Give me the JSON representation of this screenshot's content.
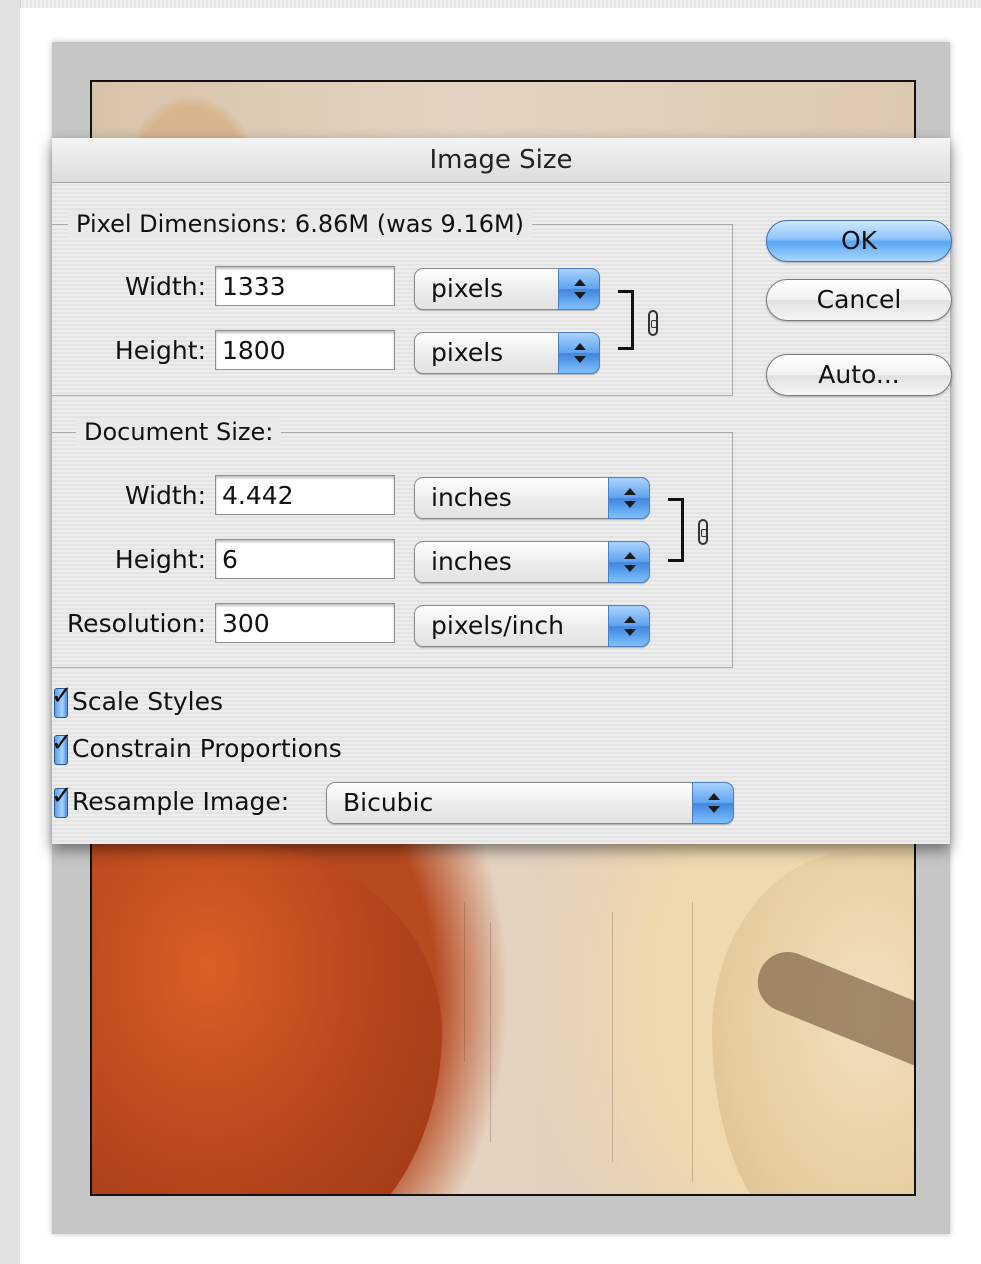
{
  "dialog": {
    "title": "Image Size",
    "pixel_dimensions": {
      "legend": "Pixel Dimensions:  6.86M (was 9.16M)",
      "width_label": "Width:",
      "width_value": "1333",
      "width_unit": "pixels",
      "height_label": "Height:",
      "height_value": "1800",
      "height_unit": "pixels"
    },
    "document_size": {
      "legend": "Document Size:",
      "width_label": "Width:",
      "width_value": "4.442",
      "width_unit": "inches",
      "height_label": "Height:",
      "height_value": "6",
      "height_unit": "inches",
      "resolution_label": "Resolution:",
      "resolution_value": "300",
      "resolution_unit": "pixels/inch"
    },
    "options": {
      "scale_styles": {
        "label": "Scale Styles",
        "checked": true
      },
      "constrain_proportions": {
        "label": "Constrain Proportions",
        "checked": true
      },
      "resample_image": {
        "label": "Resample Image:",
        "checked": true,
        "method": "Bicubic"
      }
    },
    "buttons": {
      "ok": "OK",
      "cancel": "Cancel",
      "auto": "Auto..."
    }
  },
  "icons": {
    "chain": "link-chain-icon",
    "checkmark": "✓",
    "popup_arrows": "up-down-arrows-icon"
  },
  "colors": {
    "accent_blue": "#5aa6f3",
    "dialog_bg": "#e8e8e8",
    "canvas_gray": "#c6c6c6"
  }
}
